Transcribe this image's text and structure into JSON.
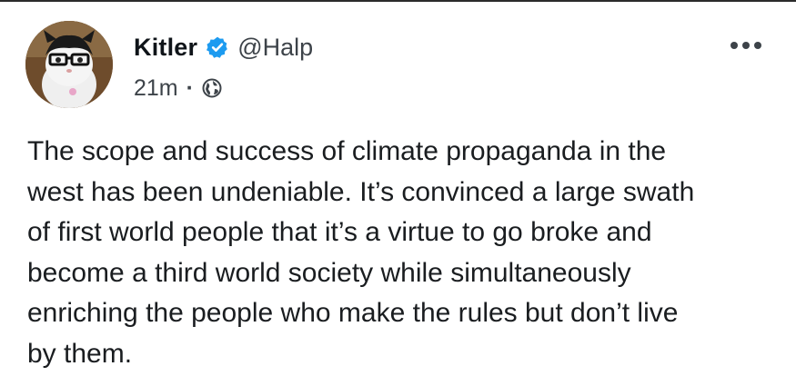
{
  "tweet": {
    "author": {
      "display_name": "Kitler",
      "handle": "@Halp",
      "verified_icon": "verified-badge-icon",
      "avatar_icon": "avatar"
    },
    "meta": {
      "timestamp": "21m",
      "separator": "·",
      "visibility_icon": "globe-icon"
    },
    "more_icon": "more-options-icon",
    "text": "The scope and success of climate propaganda in the\nwest has been undeniable. It’s convinced a large swath\nof first world people that it’s a virtue to go broke and\nbecome a third world society while simultaneously\nenriching the people who make the rules but don’t live\nby them.",
    "colors": {
      "verified_blue": "#1d9bf0",
      "text_primary": "#0f1419",
      "text_secondary": "#3d4349"
    }
  }
}
